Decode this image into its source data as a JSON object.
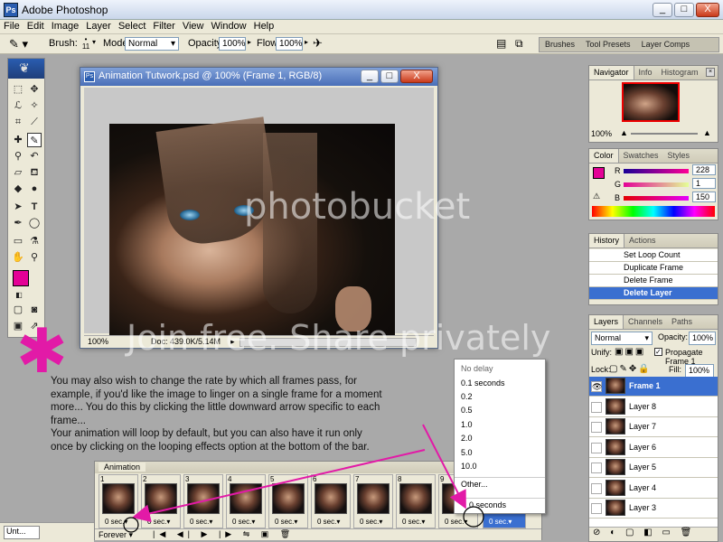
{
  "app": {
    "title": "Adobe Photoshop",
    "window_buttons": [
      "_",
      "□",
      "X"
    ]
  },
  "menu": [
    "File",
    "Edit",
    "Image",
    "Layer",
    "Select",
    "Filter",
    "View",
    "Window",
    "Help"
  ],
  "options_bar": {
    "brush_label": "Brush:",
    "brush_size": "11",
    "mode_label": "Mode:",
    "mode_value": "Normal",
    "opacity_label": "Opacity:",
    "opacity_value": "100%",
    "flow_label": "Flow:",
    "flow_value": "100%",
    "palette_wells": [
      "Brushes",
      "Tool Presets",
      "Layer Comps"
    ]
  },
  "document": {
    "title": "Animation Tutwork.psd @ 100% (Frame 1, RGB/8)",
    "zoom": "100%",
    "doc_size": "Doc: 439.0K/5.14M"
  },
  "navigator": {
    "tabs": [
      "Navigator",
      "Info",
      "Histogram"
    ],
    "zoom": "100%"
  },
  "color": {
    "tabs": [
      "Color",
      "Swatches",
      "Styles"
    ],
    "channels": [
      {
        "label": "R",
        "value": "228",
        "color": "#e4016b"
      },
      {
        "label": "G",
        "value": "1",
        "color": "#2ba42b"
      },
      {
        "label": "B",
        "value": "150",
        "color": "#3b3bd8"
      }
    ],
    "foreground": "#e40196"
  },
  "history": {
    "tabs": [
      "History",
      "Actions"
    ],
    "items": [
      "Set Loop Count",
      "Duplicate Frame",
      "Delete Frame",
      "Delete Layer"
    ],
    "selected": 3
  },
  "layers": {
    "tabs": [
      "Layers",
      "Channels",
      "Paths"
    ],
    "blend": "Normal",
    "opacity_label": "Opacity:",
    "opacity": "100%",
    "unify_label": "Unify:",
    "propagate": "Propagate Frame 1",
    "lock_label": "Lock:",
    "fill_label": "Fill:",
    "fill": "100%",
    "items": [
      "Frame 1",
      "Layer 8",
      "Layer 7",
      "Layer 6",
      "Layer 5",
      "Layer 4",
      "Layer 3"
    ]
  },
  "animation": {
    "tab": "Animation",
    "loop": "Forever",
    "frames": [
      {
        "n": "1",
        "delay": "0 sec."
      },
      {
        "n": "2",
        "delay": "0 sec."
      },
      {
        "n": "3",
        "delay": "0 sec."
      },
      {
        "n": "4",
        "delay": "0 sec."
      },
      {
        "n": "5",
        "delay": "0 sec."
      },
      {
        "n": "6",
        "delay": "0 sec."
      },
      {
        "n": "7",
        "delay": "0 sec."
      },
      {
        "n": "8",
        "delay": "0 sec."
      },
      {
        "n": "9",
        "delay": "0 sec."
      }
    ]
  },
  "delay_menu": {
    "items": [
      "No delay",
      "0.1 seconds",
      "0.2",
      "0.5",
      "1.0",
      "2.0",
      "5.0",
      "10.0",
      "Other...",
      "0 seconds"
    ]
  },
  "tutorial": {
    "lines": [
      "You may also wish to change the rate by which all frames pass, for",
      "example, if you'd like the image to linger on a single frame for a moment",
      "more... You do this by clicking the little downward arrow specific to each",
      "frame...",
      "Your animation will loop by default, but you can also have it run only",
      "once by clicking on the looping effects option at the bottom of the bar."
    ]
  },
  "watermark": {
    "brand": "photobucket",
    "tagline": "Join free. Share privately"
  },
  "taskbar": {
    "item": "Unt..."
  },
  "colors": {
    "accent": "#e21aa7",
    "selection": "#3a6fd0"
  }
}
